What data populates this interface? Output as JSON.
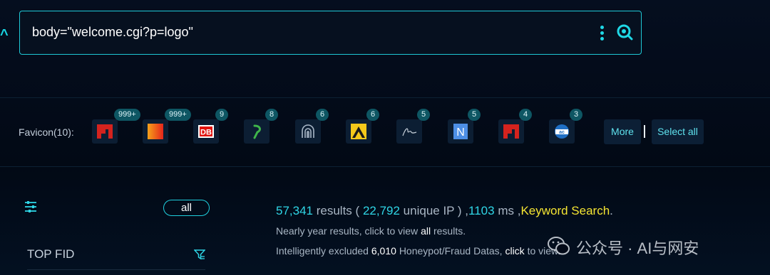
{
  "search": {
    "query": "body=\"welcome.cgi?p=logo\"",
    "icons": [
      "more-vertical-icon",
      "search-icon"
    ]
  },
  "favicons": {
    "label": "Favicon(10):",
    "items": [
      {
        "count": "999+",
        "icon": "red-bracket-logo"
      },
      {
        "count": "999+",
        "icon": "orange-gradient-logo"
      },
      {
        "count": "9",
        "icon": "db-logo",
        "text": "DB"
      },
      {
        "count": "8",
        "icon": "green-leaf-logo"
      },
      {
        "count": "6",
        "icon": "concentric-arch-logo"
      },
      {
        "count": "6",
        "icon": "yellow-black-logo"
      },
      {
        "count": "5",
        "icon": "signature-logo"
      },
      {
        "count": "5",
        "icon": "n-logo",
        "text": "N"
      },
      {
        "count": "4",
        "icon": "red-bracket-logo"
      },
      {
        "count": "3",
        "icon": "globe-badge-logo"
      }
    ],
    "more_label": "More",
    "select_all_label": "Select all"
  },
  "filters": {
    "all_label": "all",
    "top_fid_label": "TOP FID"
  },
  "results": {
    "total": "57,341",
    "results_word": "results (",
    "unique_ip": "22,792",
    "unique_ip_word": "unique IP ) ,",
    "time": "1103",
    "time_unit": "ms ,",
    "keyword_search": "Keyword Search",
    "period": ".",
    "line2_prefix": "Nearly year results, click to view",
    "line2_link": "all",
    "line2_suffix": "results.",
    "line3_prefix": "Intelligently excluded",
    "excluded": "6,010",
    "line3_mid": "Honeypot/Fraud Datas,",
    "line3_link": "click",
    "line3_suffix": "to view."
  },
  "watermark": {
    "text": "公众号 · AI与网安"
  },
  "colors": {
    "accent": "#1fd0de",
    "keyword": "#f5e532",
    "background": "#030a17"
  }
}
